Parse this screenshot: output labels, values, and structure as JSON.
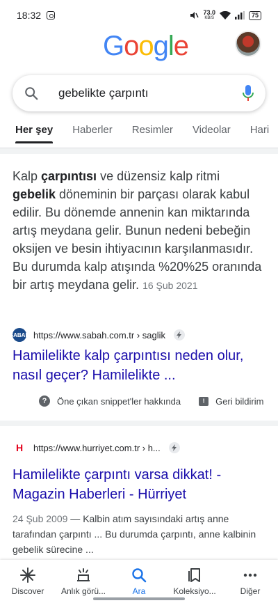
{
  "status_bar": {
    "time": "18:32",
    "net_speed": "73.0",
    "net_unit": "KB/S",
    "battery": "75"
  },
  "header": {
    "logo_letters": [
      "G",
      "o",
      "o",
      "g",
      "l",
      "e"
    ],
    "logo_colors": [
      "#4285F4",
      "#EA4335",
      "#FBBC05",
      "#4285F4",
      "#34A853",
      "#EA4335"
    ]
  },
  "search": {
    "query": "gebelikte çarpıntı"
  },
  "tabs": [
    {
      "label": "Her şey",
      "active": true
    },
    {
      "label": "Haberler"
    },
    {
      "label": "Resimler"
    },
    {
      "label": "Videolar"
    },
    {
      "label": "Hari"
    }
  ],
  "featured": {
    "snippet_parts": [
      {
        "text": "Kalp ",
        "bold": false
      },
      {
        "text": "çarpıntısı",
        "bold": true
      },
      {
        "text": " ve düzensiz kalp ritmi ",
        "bold": false
      },
      {
        "text": "gebelik",
        "bold": true
      },
      {
        "text": " döneminin bir parçası olarak kabul edilir. Bu dönemde annenin kan miktarında artış meydana gelir. Bunun nedeni bebeğin oksijen ve besin ihtiyacının karşılanmasıdır. Bu durumda kalp atışında %20%25 oranında bir artış meydana gelir. ",
        "bold": false
      }
    ],
    "date": "16 Şub 2021",
    "favicon_text": "SABAH",
    "url": "https://www.sabah.com.tr › saglik",
    "title": "Hamilelikte kalp çarpıntısı neden olur, nasıl geçer? Hamilelikte ...",
    "about_label": "Öne çıkan snippet'ler hakkında",
    "feedback_label": "Geri bildirim"
  },
  "result2": {
    "favicon_text": "H",
    "url": "https://www.hurriyet.com.tr › h...",
    "title": "Hamilelikte çarpıntı varsa dikkat! - Magazin Haberleri - Hürriyet",
    "date": "24 Şub 2009",
    "dash": " — ",
    "description": "Kalbin atım sayısındaki artış anne tarafından çarpıntı ... Bu durumda çarpıntı, anne kalbinin gebelik sürecine ..."
  },
  "bottom_nav": [
    {
      "label": "Discover",
      "icon": "asterisk-icon"
    },
    {
      "label": "Anlık görü...",
      "icon": "snapshot-icon"
    },
    {
      "label": "Ara",
      "icon": "search-icon",
      "active": true
    },
    {
      "label": "Koleksiyo...",
      "icon": "collections-icon"
    },
    {
      "label": "Diğer",
      "icon": "more-icon"
    }
  ],
  "colors": {
    "link": "#1a0dab",
    "active_nav": "#1a73e8"
  }
}
